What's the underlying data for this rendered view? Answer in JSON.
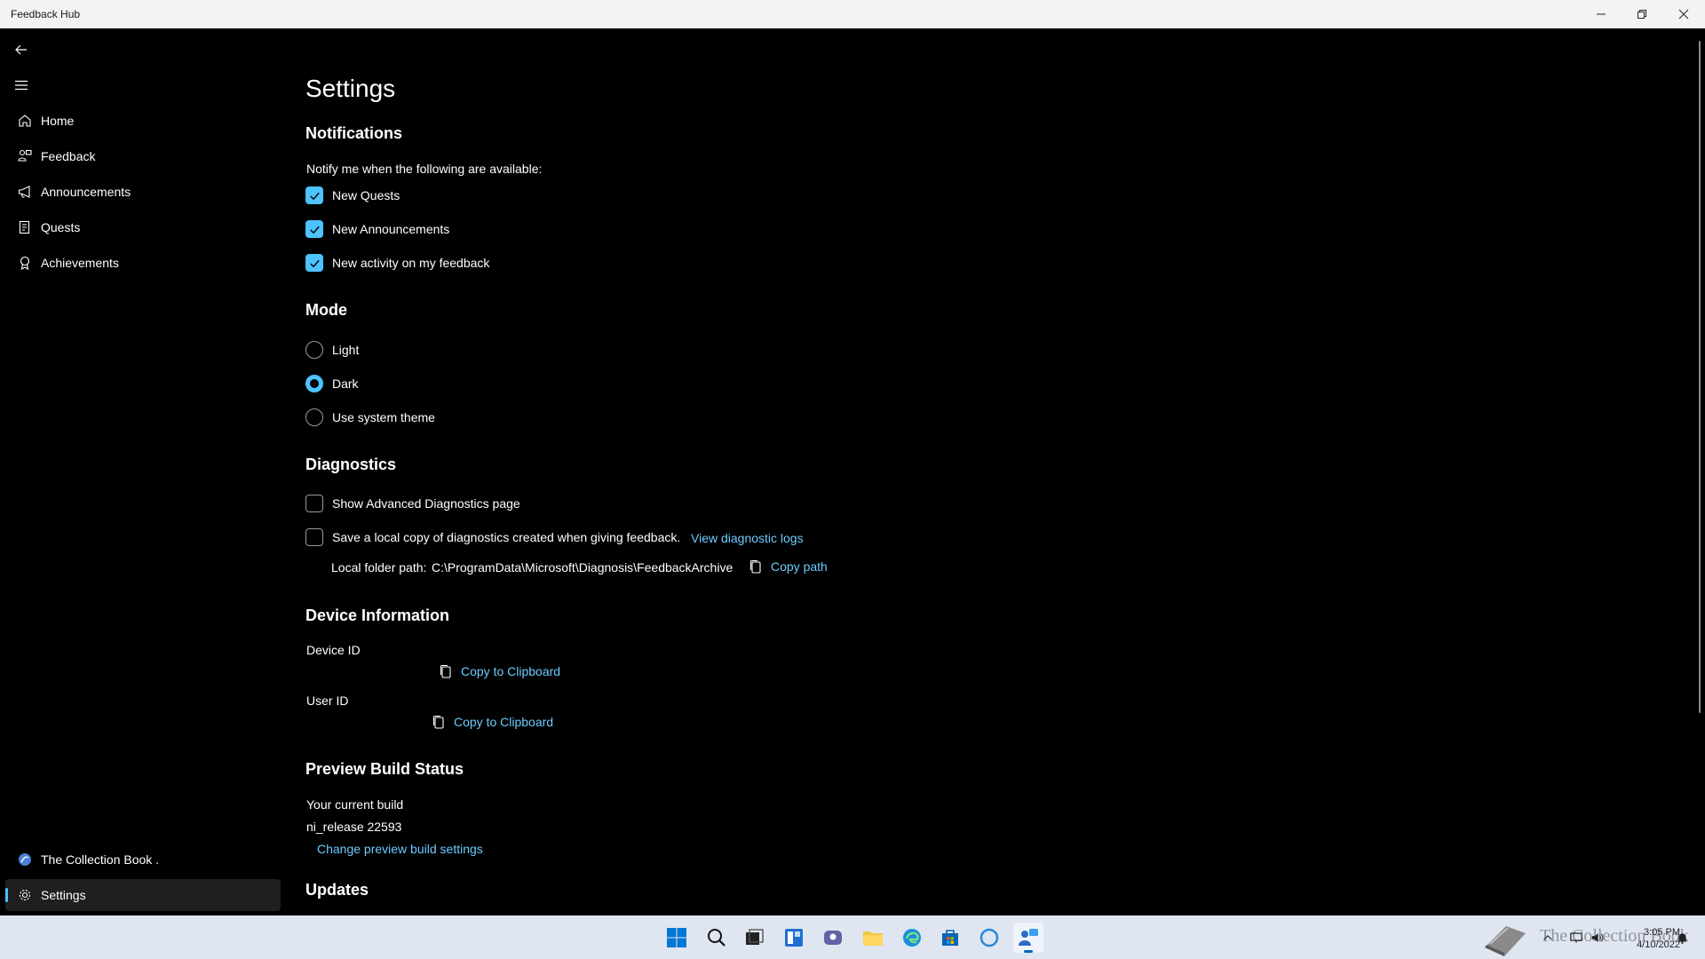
{
  "window": {
    "title": "Feedback Hub"
  },
  "nav": {
    "items": [
      {
        "label": "Home",
        "icon": "home-icon"
      },
      {
        "label": "Feedback",
        "icon": "feedback-icon"
      },
      {
        "label": "Announcements",
        "icon": "megaphone-icon"
      },
      {
        "label": "Quests",
        "icon": "quests-icon"
      },
      {
        "label": "Achievements",
        "icon": "achievement-icon"
      }
    ],
    "account_label": "The Collection Book .",
    "settings_label": "Settings"
  },
  "settings": {
    "title": "Settings",
    "notifications": {
      "heading": "Notifications",
      "intro": "Notify me when the following are available:",
      "options": [
        {
          "label": "New Quests",
          "checked": true
        },
        {
          "label": "New Announcements",
          "checked": true
        },
        {
          "label": "New activity on my feedback",
          "checked": true
        }
      ]
    },
    "mode": {
      "heading": "Mode",
      "options": [
        {
          "label": "Light",
          "selected": false
        },
        {
          "label": "Dark",
          "selected": true
        },
        {
          "label": "Use system theme",
          "selected": false
        }
      ]
    },
    "diagnostics": {
      "heading": "Diagnostics",
      "show_advanced_label": "Show Advanced Diagnostics page",
      "save_local_label": "Save a local copy of diagnostics created when giving feedback.",
      "view_logs_link": "View diagnostic logs",
      "folder_path_label": "Local folder path:",
      "folder_path_value": "C:\\ProgramData\\Microsoft\\Diagnosis\\FeedbackArchive",
      "copy_path_label": "Copy path"
    },
    "device_info": {
      "heading": "Device Information",
      "device_id_label": "Device ID",
      "user_id_label": "User ID",
      "copy_label": "Copy to Clipboard"
    },
    "preview_build": {
      "heading": "Preview Build Status",
      "current_build_label": "Your current build",
      "build_value": "ni_release 22593",
      "change_link": "Change preview build settings"
    },
    "updates": {
      "heading": "Updates"
    }
  },
  "taskbar": {
    "clock_time": "3:05 PM",
    "clock_date": "4/10/2022",
    "watermark": "The Collection Book"
  },
  "colors": {
    "accent": "#4cc2ff",
    "link": "#6ccbff",
    "background": "#000000"
  }
}
